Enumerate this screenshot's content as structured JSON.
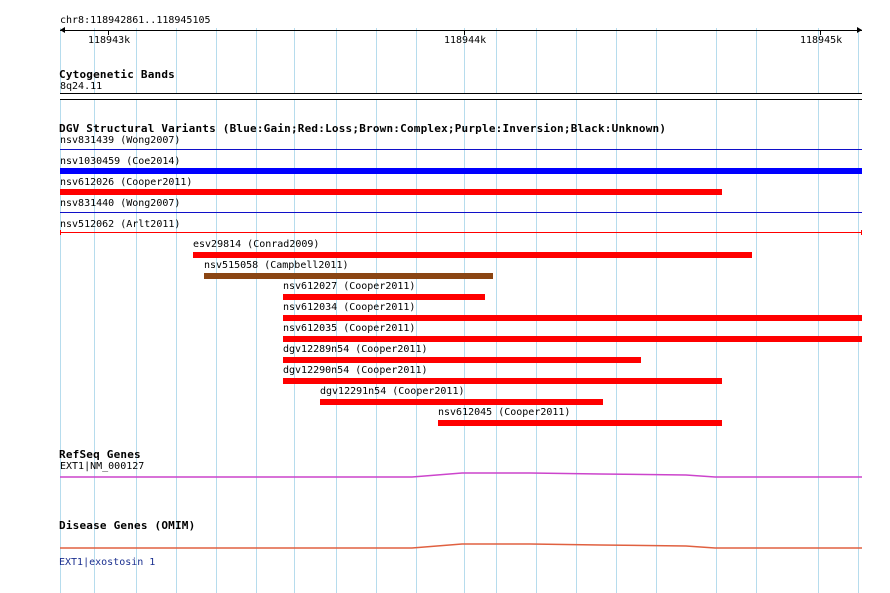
{
  "ruler": {
    "position": "chr8:118942861..118945105",
    "ticks": [
      "118943k",
      "118944k",
      "118945k"
    ]
  },
  "cytoband": {
    "title": "Cytogenetic Bands",
    "band": "8q24.11"
  },
  "dgv": {
    "title": "DGV Structural Variants (Blue:Gain;Red:Loss;Brown:Complex;Purple:Inversion;Black:Unknown)",
    "variants": [
      {
        "label": "nsv831439 (Wong2007)",
        "color": "#1010c8",
        "type": "line"
      },
      {
        "label": "nsv1030459 (Coe2014)",
        "color": "#0000ff",
        "type": "bar"
      },
      {
        "label": "nsv612026 (Cooper2011)",
        "color": "#ff0000",
        "type": "bar"
      },
      {
        "label": "nsv831440 (Wong2007)",
        "color": "#1010c8",
        "type": "line"
      },
      {
        "label": "nsv512062 (Arlt2011)",
        "color": "#ff0000",
        "type": "line"
      },
      {
        "label": "esv29814 (Conrad2009)",
        "color": "#ff0000",
        "type": "bar"
      },
      {
        "label": "nsv515058 (Campbell2011)",
        "color": "#8b4513",
        "type": "bar"
      },
      {
        "label": "nsv612027 (Cooper2011)",
        "color": "#ff0000",
        "type": "bar"
      },
      {
        "label": "nsv612034 (Cooper2011)",
        "color": "#ff0000",
        "type": "bar"
      },
      {
        "label": "nsv612035 (Cooper2011)",
        "color": "#ff0000",
        "type": "bar"
      },
      {
        "label": "dgv12289n54 (Cooper2011)",
        "color": "#ff0000",
        "type": "bar"
      },
      {
        "label": "dgv12290n54 (Cooper2011)",
        "color": "#ff0000",
        "type": "bar"
      },
      {
        "label": "dgv12291n54 (Cooper2011)",
        "color": "#ff0000",
        "type": "bar"
      },
      {
        "label": "nsv612045 (Cooper2011)",
        "color": "#ff0000",
        "type": "bar"
      }
    ]
  },
  "refseq": {
    "title": "RefSeq Genes",
    "gene": "EXT1|NM_000127",
    "color": "#cc44cc"
  },
  "disease": {
    "title": "Disease Genes (OMIM)",
    "gene": "EXT1|exostosin 1",
    "color": "#e06040"
  }
}
